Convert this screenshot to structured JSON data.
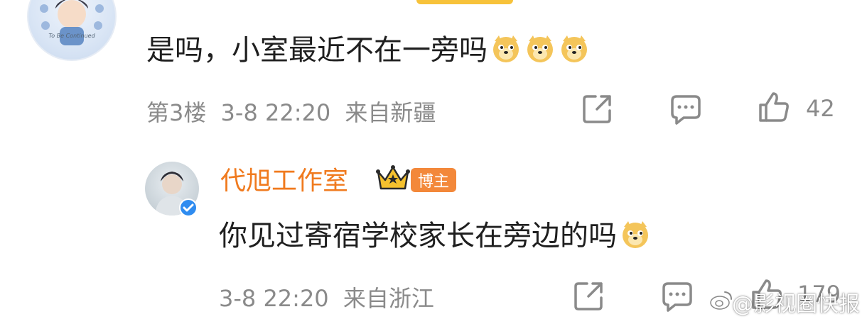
{
  "comment1": {
    "author_partial": "",
    "text": "是吗，小室最近不在一旁吗",
    "emoji_count": 3,
    "floor": "第3楼",
    "time": "3-8 22:20",
    "location": "来自新疆",
    "like_count": "42"
  },
  "comment2": {
    "author": "代旭工作室",
    "tag": "博主",
    "text": "你见过寄宿学校家长在旁边的吗",
    "emoji_count": 1,
    "time": "3-8 22:20",
    "location": "来自浙江",
    "like_count": "179"
  },
  "watermark": "@影视圈快报",
  "avatar1_text": "To Be Continued",
  "icons": [
    "share-icon",
    "comment-icon",
    "like-icon",
    "verified-icon",
    "crown-icon",
    "doge-emoji",
    "weibo-logo-icon"
  ],
  "colors": {
    "author": "#f07a1e",
    "tag": "#f3883a",
    "meta": "#8a8a8a",
    "verified": "#2f8cf0"
  }
}
